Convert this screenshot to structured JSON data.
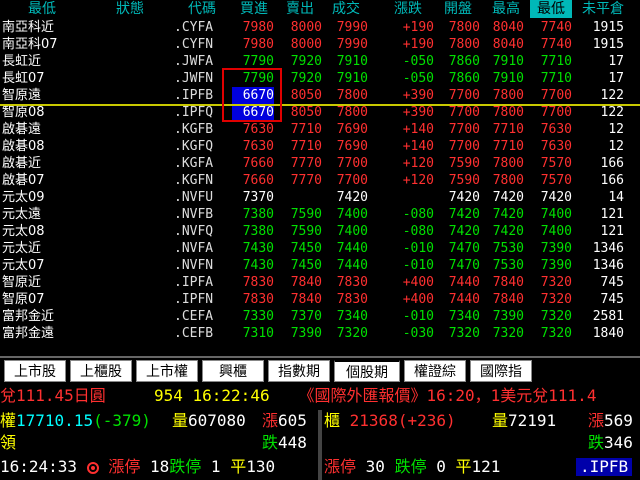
{
  "header": {
    "columns": [
      "最低",
      "狀態",
      "代碼",
      "買進",
      "賣出",
      "成交",
      "漲跌",
      "開盤",
      "最高",
      "最低",
      "未平倉"
    ],
    "selected_index": 9
  },
  "rows": [
    {
      "name": "南亞科近",
      "code": ".CYFA",
      "bid": "7980",
      "ask": "8000",
      "last": "7990",
      "chg": "+190",
      "open": "7800",
      "high": "8040",
      "low": "7740",
      "vol": "1915"
    },
    {
      "name": "南亞科07",
      "code": ".CYFN",
      "bid": "7980",
      "ask": "8000",
      "last": "7990",
      "chg": "+190",
      "open": "7800",
      "high": "8040",
      "low": "7740",
      "vol": "1915"
    },
    {
      "name": "長虹近",
      "code": ".JWFA",
      "bid": "7790",
      "ask": "7920",
      "last": "7910",
      "chg": "-050",
      "open": "7860",
      "high": "7910",
      "low": "7710",
      "vol": "17"
    },
    {
      "name": "長虹07",
      "code": ".JWFN",
      "bid": "7790",
      "ask": "7920",
      "last": "7910",
      "chg": "-050",
      "open": "7860",
      "high": "7910",
      "low": "7710",
      "vol": "17"
    },
    {
      "name": "智原遠",
      "code": ".IPFB",
      "bid": "6670",
      "ask": "8050",
      "last": "7800",
      "chg": "+390",
      "open": "7700",
      "high": "7800",
      "low": "7700",
      "vol": "122"
    },
    {
      "name": "智原08",
      "code": ".IPFQ",
      "bid": "6670",
      "ask": "8050",
      "last": "7800",
      "chg": "+390",
      "open": "7700",
      "high": "7800",
      "low": "7700",
      "vol": "122"
    },
    {
      "name": "啟碁遠",
      "code": ".KGFB",
      "bid": "7630",
      "ask": "7710",
      "last": "7690",
      "chg": "+140",
      "open": "7700",
      "high": "7710",
      "low": "7630",
      "vol": "12"
    },
    {
      "name": "啟碁08",
      "code": ".KGFQ",
      "bid": "7630",
      "ask": "7710",
      "last": "7690",
      "chg": "+140",
      "open": "7700",
      "high": "7710",
      "low": "7630",
      "vol": "12"
    },
    {
      "name": "啟碁近",
      "code": ".KGFA",
      "bid": "7660",
      "ask": "7770",
      "last": "7700",
      "chg": "+120",
      "open": "7590",
      "high": "7800",
      "low": "7570",
      "vol": "166"
    },
    {
      "name": "啟碁07",
      "code": ".KGFN",
      "bid": "7660",
      "ask": "7770",
      "last": "7700",
      "chg": "+120",
      "open": "7590",
      "high": "7800",
      "low": "7570",
      "vol": "166"
    },
    {
      "name": "元太09",
      "code": ".NVFU",
      "bid": "7370",
      "ask": "",
      "last": "7420",
      "chg": "",
      "open": "7420",
      "high": "7420",
      "low": "7420",
      "vol": "14"
    },
    {
      "name": "元太遠",
      "code": ".NVFB",
      "bid": "7380",
      "ask": "7590",
      "last": "7400",
      "chg": "-080",
      "open": "7420",
      "high": "7420",
      "low": "7400",
      "vol": "121"
    },
    {
      "name": "元太08",
      "code": ".NVFQ",
      "bid": "7380",
      "ask": "7590",
      "last": "7400",
      "chg": "-080",
      "open": "7420",
      "high": "7420",
      "low": "7400",
      "vol": "121"
    },
    {
      "name": "元太近",
      "code": ".NVFA",
      "bid": "7430",
      "ask": "7450",
      "last": "7440",
      "chg": "-010",
      "open": "7470",
      "high": "7530",
      "low": "7390",
      "vol": "1346"
    },
    {
      "name": "元太07",
      "code": ".NVFN",
      "bid": "7430",
      "ask": "7450",
      "last": "7440",
      "chg": "-010",
      "open": "7470",
      "high": "7530",
      "low": "7390",
      "vol": "1346"
    },
    {
      "name": "智原近",
      "code": ".IPFA",
      "bid": "7830",
      "ask": "7840",
      "last": "7830",
      "chg": "+400",
      "open": "7440",
      "high": "7840",
      "low": "7320",
      "vol": "745"
    },
    {
      "name": "智原07",
      "code": ".IPFN",
      "bid": "7830",
      "ask": "7840",
      "last": "7830",
      "chg": "+400",
      "open": "7440",
      "high": "7840",
      "low": "7320",
      "vol": "745"
    },
    {
      "name": "富邦金近",
      "code": ".CEFA",
      "bid": "7330",
      "ask": "7370",
      "last": "7340",
      "chg": "-010",
      "open": "7340",
      "high": "7390",
      "low": "7320",
      "vol": "2581"
    },
    {
      "name": "富邦金遠",
      "code": ".CEFB",
      "bid": "7310",
      "ask": "7390",
      "last": "7320",
      "chg": "-030",
      "open": "7320",
      "high": "7320",
      "low": "7320",
      "vol": "1840"
    }
  ],
  "tabs": [
    "上市股",
    "上櫃股",
    "上市權",
    "興櫃",
    "指數期",
    "個股期",
    "權證綜",
    "國際指"
  ],
  "active_tab": 5,
  "ticker": {
    "left": "兌111.45日圓",
    "time": "954 16:22:46",
    "news": "《國際外匯報價》16:20，1美元兌111.4"
  },
  "left_panel": {
    "index_label": "權",
    "index_value": "17710.15",
    "index_change": "(-379)",
    "volume_label": "量",
    "volume_value": "607080",
    "up_label": "漲",
    "up_value": "605",
    "lead_label": "領",
    "down_label": "跌",
    "down_value": "448",
    "clock": "16:24:33",
    "limit_up_label": "漲停",
    "limit_up_value": "18",
    "limit_down_label": "跌停",
    "limit_down_value": "1",
    "flat_label": "平",
    "flat_value": "130"
  },
  "right_panel": {
    "index_label": "櫃",
    "index_value": "21368",
    "index_change": "(+236)",
    "volume_label": "量",
    "volume_value": "72191",
    "up_label": "漲",
    "up_value": "569",
    "down_label": "跌",
    "down_value": "346",
    "limit_up_label": "漲停",
    "limit_up_value": "30",
    "limit_down_label": "跌停",
    "limit_down_value": "0",
    "flat_label": "平",
    "flat_value": "121",
    "code_badge": ".IPFB"
  }
}
